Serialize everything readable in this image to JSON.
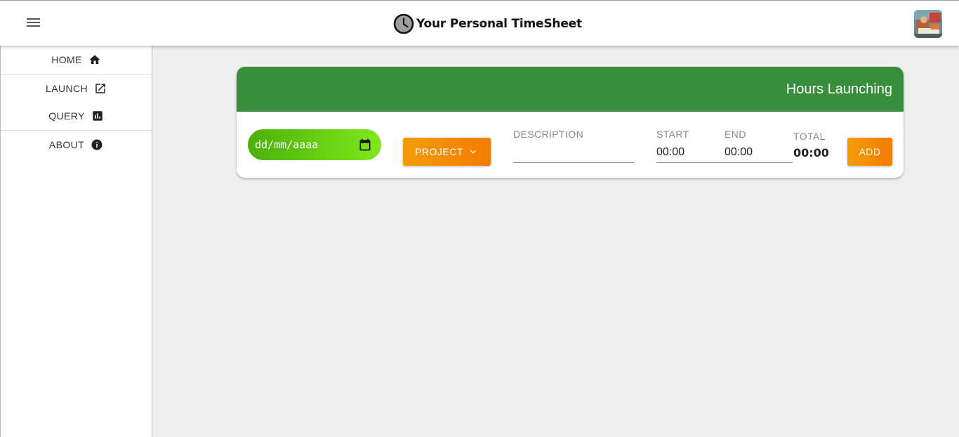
{
  "header": {
    "app_title": "Your Personal TimeSheet",
    "menu_icon": "menu-icon",
    "logo_icon": "clock-icon",
    "avatar": "user-avatar"
  },
  "sidebar": {
    "items": [
      {
        "label": "HOME",
        "icon": "home-icon"
      },
      {
        "label": "LAUNCH",
        "icon": "open-in-new-icon"
      },
      {
        "label": "QUERY",
        "icon": "bar-chart-icon"
      },
      {
        "label": "ABOUT",
        "icon": "info-icon"
      }
    ]
  },
  "card": {
    "title": "Hours Launching",
    "header_color": "#388e3c",
    "date_placeholder": "dd/mm/aaaa",
    "project_label": "PROJECT",
    "description_label": "DESCRIPTION",
    "description_value": "",
    "start_label": "START",
    "start_value": "00:00",
    "end_label": "END",
    "end_value": "00:00",
    "total_label": "TOTAL",
    "total_value": "00:00",
    "add_label": "ADD",
    "accent_color": "#f57c00"
  }
}
